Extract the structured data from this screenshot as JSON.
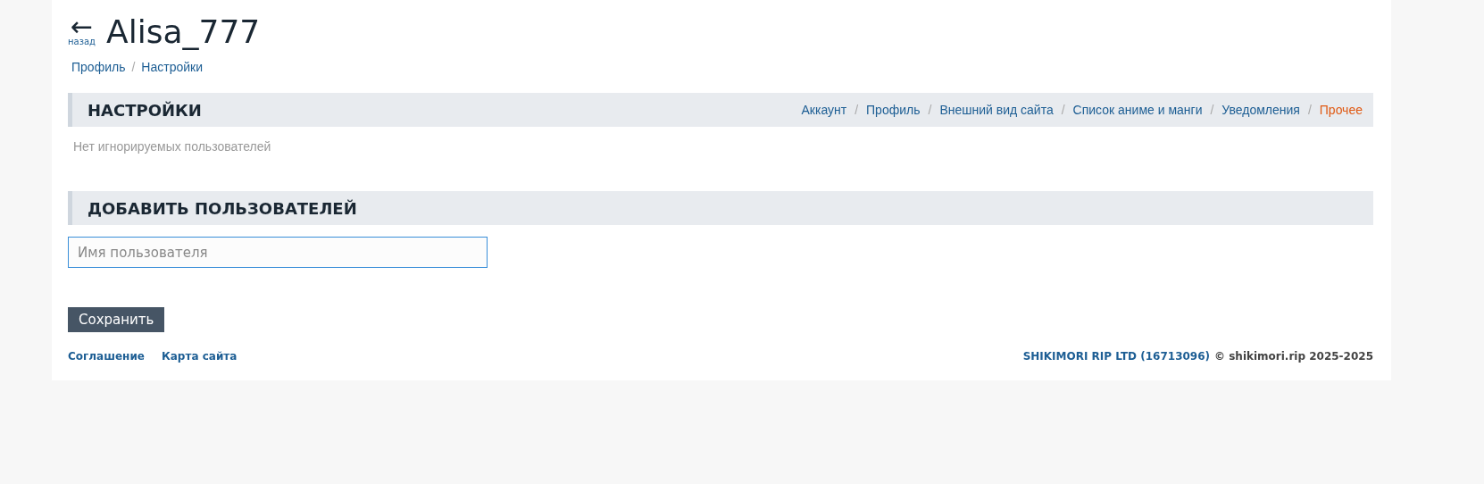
{
  "header": {
    "back_label": "назад",
    "back_arrow": "←",
    "title": "Alisa_777"
  },
  "breadcrumbs": {
    "separator": "/",
    "items": [
      "Профиль",
      "Настройки"
    ]
  },
  "settings_section": {
    "title": "НАСТРОЙКИ",
    "separator": "/",
    "tabs": [
      {
        "label": "Аккаунт",
        "selected": false
      },
      {
        "label": "Профиль",
        "selected": false
      },
      {
        "label": "Внешний вид сайта",
        "selected": false
      },
      {
        "label": "Список аниме и манги",
        "selected": false
      },
      {
        "label": "Уведомления",
        "selected": false
      },
      {
        "label": "Прочее",
        "selected": true
      }
    ],
    "empty_text": "Нет игнорируемых пользователей"
  },
  "add_section": {
    "title": "ДОБАВИТЬ ПОЛЬЗОВАТЕЛЕЙ",
    "input": {
      "placeholder": "Имя пользователя"
    }
  },
  "save_button": "Сохранить",
  "footer": {
    "links": [
      "Соглашение",
      "Карта сайта"
    ],
    "company": "SHIKIMORI RIP LTD (16713096)",
    "copyright": "© shikimori.rip 2025-2025"
  }
}
